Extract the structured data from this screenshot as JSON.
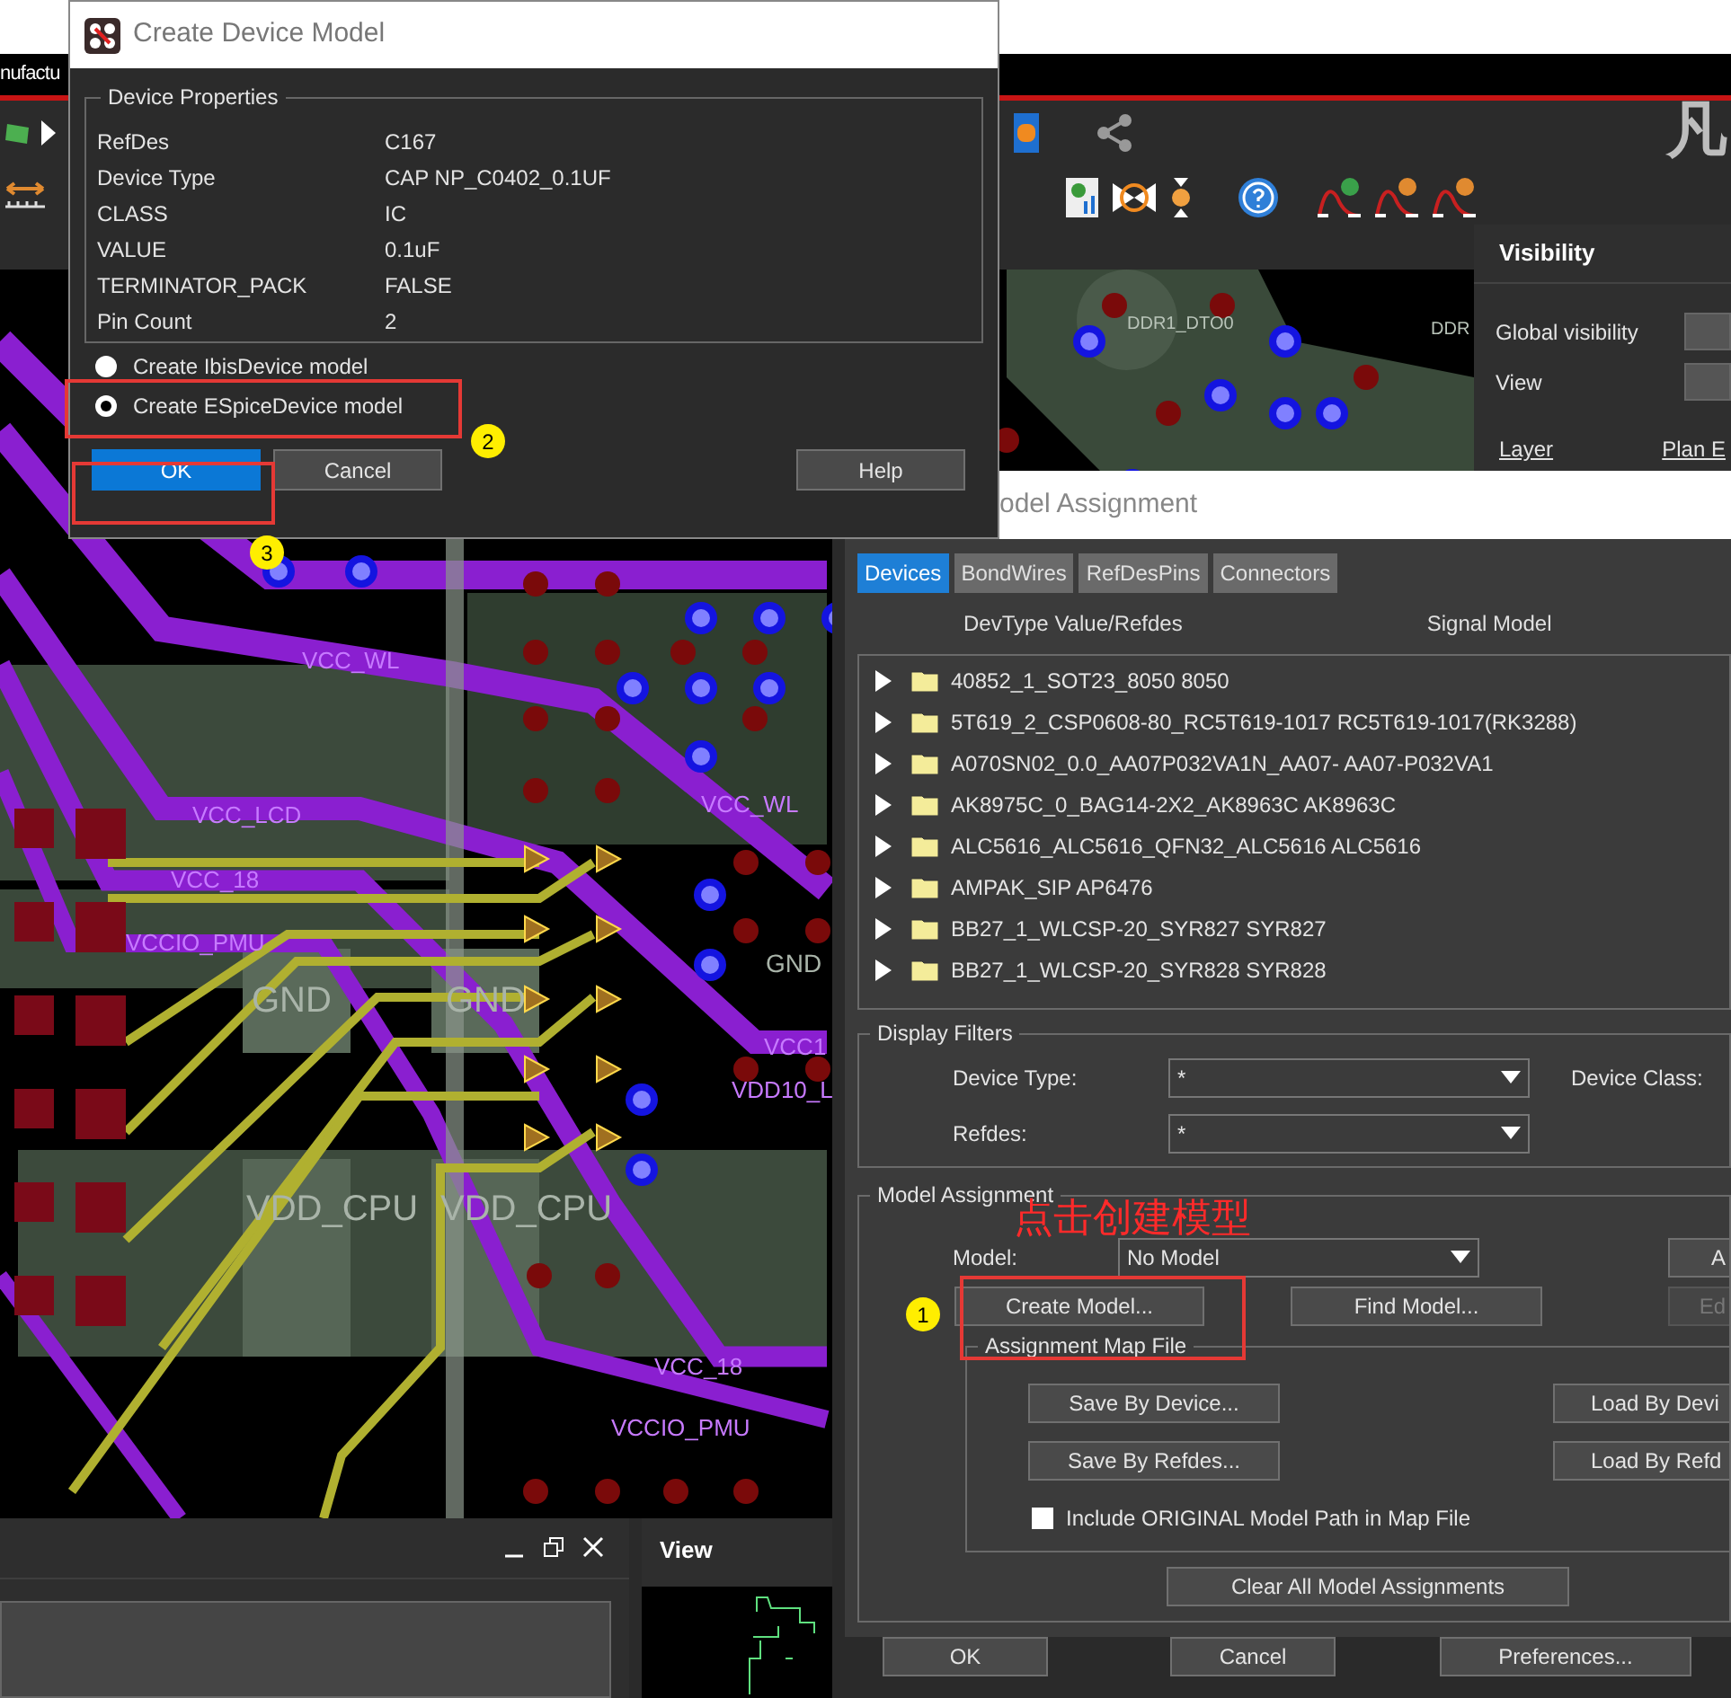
{
  "app": {
    "menu_text": "nufactu",
    "brand_glyph": "凡"
  },
  "pcb_labels": [
    {
      "text": "VCC_WL",
      "kind": "net"
    },
    {
      "text": "VCC_LCD",
      "kind": "net"
    },
    {
      "text": "VCC_18",
      "kind": "net"
    },
    {
      "text": "VCCIO_PMU",
      "kind": "net"
    },
    {
      "text": "GND",
      "kind": "plane"
    },
    {
      "text": "GND",
      "kind": "plane"
    },
    {
      "text": "VDD_CPU",
      "kind": "plane"
    },
    {
      "text": "VDD_CPU",
      "kind": "plane"
    },
    {
      "text": "VCC_WL",
      "kind": "net"
    },
    {
      "text": "GND",
      "kind": "plane"
    },
    {
      "text": "VCC1",
      "kind": "net"
    },
    {
      "text": "VDD10_L",
      "kind": "net"
    },
    {
      "text": "VCC_18",
      "kind": "net"
    },
    {
      "text": "VCCIO_PMU",
      "kind": "net"
    },
    {
      "text": "DDR1_DTO0",
      "kind": "pad"
    },
    {
      "text": "DDR",
      "kind": "pad"
    }
  ],
  "visibility_panel": {
    "title": "Visibility",
    "rows": [
      "Global visibility",
      "View"
    ],
    "links": [
      "Layer",
      "Plan E"
    ]
  },
  "create_dialog": {
    "title": "Create Device Model",
    "group_title": "Device Properties",
    "properties": [
      {
        "name": "RefDes",
        "value": "C167"
      },
      {
        "name": "Device Type",
        "value": "CAP NP_C0402_0.1UF"
      },
      {
        "name": "CLASS",
        "value": "IC"
      },
      {
        "name": "VALUE",
        "value": "0.1uF"
      },
      {
        "name": "TERMINATOR_PACK",
        "value": "FALSE"
      },
      {
        "name": "Pin Count",
        "value": "2"
      }
    ],
    "options": [
      {
        "label": "Create IbisDevice model",
        "selected": false
      },
      {
        "label": "Create ESpiceDevice model",
        "selected": true
      }
    ],
    "buttons": [
      {
        "label": "OK",
        "kind": "default"
      },
      {
        "label": "Cancel",
        "kind": "normal"
      },
      {
        "label": "Help",
        "kind": "normal"
      }
    ]
  },
  "model_assignment": {
    "title": "odel Assignment",
    "tabs": [
      {
        "label": "Devices",
        "selected": true
      },
      {
        "label": "BondWires",
        "selected": false
      },
      {
        "label": "RefDesPins",
        "selected": false
      },
      {
        "label": "Connectors",
        "selected": false
      }
    ],
    "columns": [
      "DevType Value/Refdes",
      "Signal Model"
    ],
    "devices": [
      "40852_1_SOT23_8050 8050",
      "5T619_2_CSP0608-80_RC5T619-1017 RC5T619-1017(RK3288)",
      "A070SN02_0.0_AA07P032VA1N_AA07- AA07-P032VA1",
      "AK8975C_0_BAG14-2X2_AK8963C AK8963C",
      "ALC5616_ALC5616_QFN32_ALC5616 ALC5616",
      "AMPAK_SIP AP6476",
      "BB27_1_WLCSP-20_SYR827 SYR827",
      "BB27_1_WLCSP-20_SYR828 SYR828"
    ],
    "display_filters": {
      "title": "Display Filters",
      "fields": [
        {
          "label": "Device Type:",
          "value": "*"
        },
        {
          "label": "Refdes:",
          "value": "*"
        }
      ],
      "device_class_label": "Device Class:"
    },
    "assignment": {
      "title": "Model Assignment",
      "model_label": "Model:",
      "model_value": "No Model",
      "side_buttons": [
        {
          "label": "A",
          "disabled": false
        },
        {
          "label": "Ed",
          "disabled": true
        }
      ],
      "create_button": "Create Model...",
      "find_button": "Find Model...",
      "map_file": {
        "title": "Assignment Map File",
        "save_buttons": [
          "Save By Device...",
          "Save By Refdes..."
        ],
        "load_buttons": [
          "Load By Devi",
          "Load By Refd"
        ],
        "include": {
          "label": "Include ORIGINAL Model Path in Map File",
          "checked": false
        }
      },
      "clear_button": "Clear All Model Assignments"
    },
    "footer_buttons": [
      "OK",
      "Cancel",
      "Preferences..."
    ]
  },
  "view_panel": {
    "title": "View"
  },
  "annotations": {
    "markers": [
      "2",
      "3",
      "1"
    ],
    "note": "点击创建模型"
  }
}
